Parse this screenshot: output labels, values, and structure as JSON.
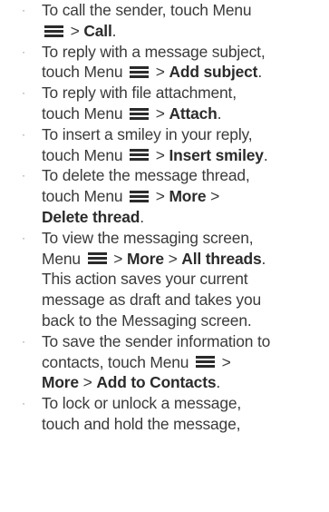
{
  "items": [
    {
      "lines": [
        [
          "To call the sender, touch Menu"
        ],
        [
          "",
          "{icon}",
          " > ",
          "Call",
          "."
        ]
      ]
    },
    {
      "lines": [
        [
          "To reply with a message subject,"
        ],
        [
          "touch Menu ",
          "{icon}",
          " > ",
          "Add subject",
          "."
        ]
      ]
    },
    {
      "lines": [
        [
          "To reply with file attachment,"
        ],
        [
          "touch Menu ",
          "{icon}",
          " > ",
          "Attach",
          "."
        ]
      ]
    },
    {
      "lines": [
        [
          "To insert a smiley in your reply,"
        ],
        [
          "touch Menu ",
          "{icon}",
          " > ",
          "Insert smiley",
          "."
        ]
      ]
    },
    {
      "lines": [
        [
          "To delete the message thread,"
        ],
        [
          "touch Menu ",
          "{icon}",
          " > ",
          "More",
          " >"
        ],
        [
          "",
          "",
          "",
          "Delete thread",
          "."
        ]
      ]
    },
    {
      "lines": [
        [
          "To view the messaging screen,"
        ],
        [
          "Menu ",
          "{icon}",
          " > ",
          "More",
          " > ",
          "All threads",
          "."
        ],
        [
          "This action saves your current"
        ],
        [
          "message as draft and takes you"
        ],
        [
          "back to the Messaging screen."
        ]
      ]
    },
    {
      "lines": [
        [
          "To save the sender information to"
        ],
        [
          "contacts, touch Menu ",
          "{icon}",
          " >"
        ],
        [
          "",
          "",
          "",
          "More",
          " > ",
          "Add to Contacts",
          "."
        ]
      ]
    },
    {
      "lines": [
        [
          "To lock or unlock a message,"
        ],
        [
          "touch and hold the message,"
        ]
      ]
    }
  ],
  "icons": {
    "menu": "menu-icon"
  }
}
